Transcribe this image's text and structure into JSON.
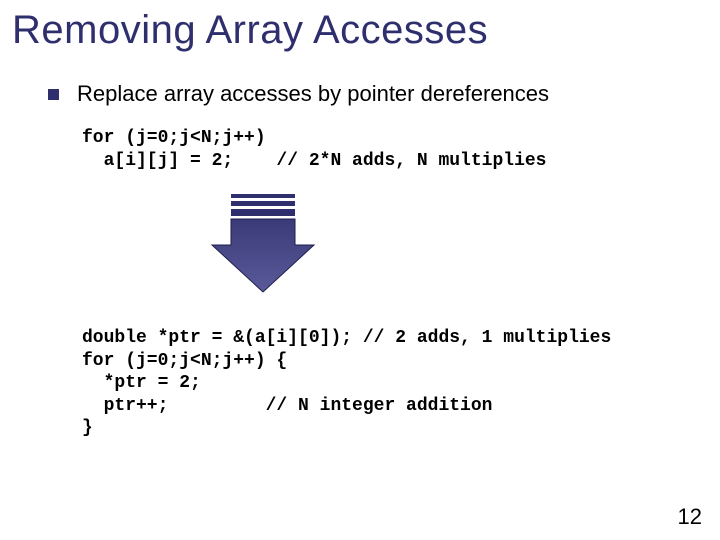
{
  "title": "Removing Array Accesses",
  "bullet": "Replace array accesses by pointer dereferences",
  "code1": {
    "l1": "for (j=0;j<N;j++)",
    "l2": "  a[i][j] = 2;    // 2*N adds, N multiplies"
  },
  "code2": {
    "l1": "double *ptr = &(a[i][0]); // 2 adds, 1 multiplies",
    "l2": "for (j=0;j<N;j++) {",
    "l3": "  *ptr = 2;",
    "l4": "  ptr++;         // N integer addition",
    "l5": "}"
  },
  "page": "12"
}
